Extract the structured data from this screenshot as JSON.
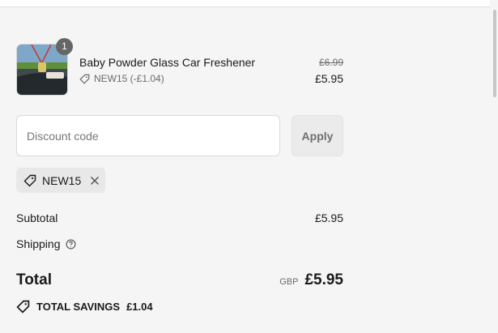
{
  "product": {
    "name": "Baby Powder Glass Car Freshener",
    "quantity": "1",
    "discount_line": "NEW15 (-£1.04)",
    "original_price": "£6.99",
    "price": "£5.95"
  },
  "discount": {
    "placeholder": "Discount code",
    "apply_label": "Apply",
    "applied_code": "NEW15"
  },
  "summary": {
    "subtotal_label": "Subtotal",
    "subtotal_value": "£5.95",
    "shipping_label": "Shipping",
    "total_label": "Total",
    "currency": "GBP",
    "total_value": "£5.95",
    "savings_label": "TOTAL SAVINGS",
    "savings_value": "£1.04"
  },
  "icons": {
    "tag": "tag-icon",
    "close": "close-icon",
    "help": "help-circle-icon"
  },
  "colors": {
    "background": "#f5f5f5",
    "badge": "#666666",
    "apply_button": "#ebebeb",
    "chip": "#e8e8e8"
  }
}
